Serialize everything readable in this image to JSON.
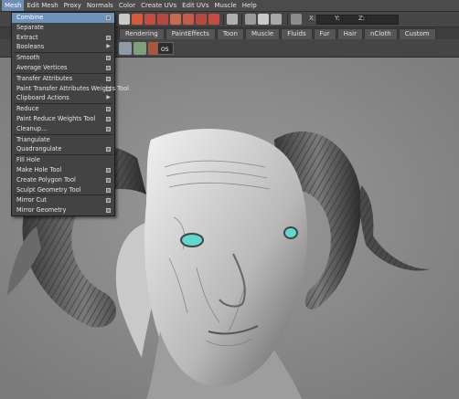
{
  "menubar": {
    "items": [
      "Mesh",
      "Edit Mesh",
      "Proxy",
      "Normals",
      "Color",
      "Create UVs",
      "Edit UVs",
      "Muscle",
      "Help"
    ],
    "active_index": 0
  },
  "status_line": {
    "x_label": "X:",
    "y_label": "Y:",
    "z_label": "Z:"
  },
  "shelf": {
    "tabs": [
      "Rendering",
      "PaintEffects",
      "Toon",
      "Muscle",
      "Fluids",
      "Fur",
      "Hair",
      "nCloth",
      "Custom"
    ],
    "os_label": "OS"
  },
  "mesh_menu": {
    "groups": [
      [
        {
          "label": "Combine",
          "option": true,
          "highlight": true
        },
        {
          "label": "Separate"
        },
        {
          "label": "Extract",
          "option": true
        },
        {
          "label": "Booleans",
          "submenu": true
        }
      ],
      [
        {
          "label": "Smooth",
          "option": true
        },
        {
          "label": "Average Vertices",
          "option": true
        }
      ],
      [
        {
          "label": "Transfer Attributes",
          "option": true
        },
        {
          "label": "Paint Transfer Attributes Weights Tool",
          "option": true
        },
        {
          "label": "Clipboard Actions",
          "submenu": true
        }
      ],
      [
        {
          "label": "Reduce",
          "option": true
        },
        {
          "label": "Paint Reduce Weights Tool",
          "option": true
        },
        {
          "label": "Cleanup...",
          "option": true
        }
      ],
      [
        {
          "label": "Triangulate"
        },
        {
          "label": "Quadrangulate",
          "option": true
        }
      ],
      [
        {
          "label": "Fill Hole"
        },
        {
          "label": "Make Hole Tool",
          "option": true
        },
        {
          "label": "Create Polygon Tool",
          "option": true
        },
        {
          "label": "Sculpt Geometry Tool",
          "option": true
        }
      ],
      [
        {
          "label": "Mirror Cut",
          "option": true
        },
        {
          "label": "Mirror Geometry",
          "option": true
        }
      ]
    ]
  },
  "colors": {
    "highlight": "#6e93bd",
    "eye": "#5fd8cf",
    "menu_bg": "#434343"
  }
}
